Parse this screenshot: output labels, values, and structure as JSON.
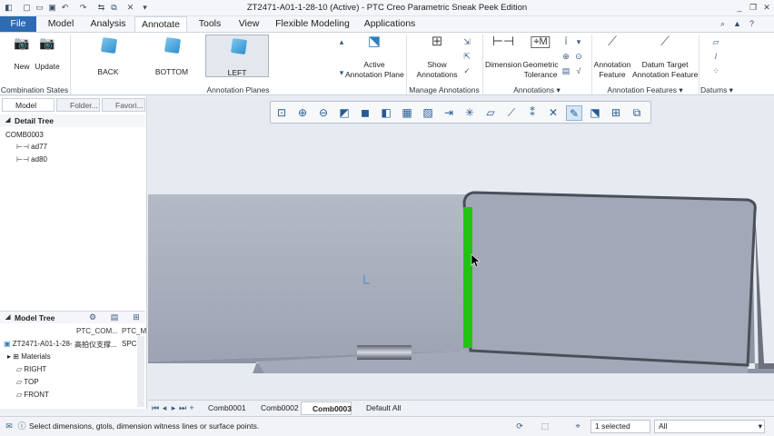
{
  "window": {
    "title": "ZT2471-A01-1-28-10 (Active) - PTC Creo Parametric Sneak Peek Edition",
    "controls": [
      "_",
      "❐",
      "✕"
    ]
  },
  "tabs": [
    "File",
    "Model",
    "Analysis",
    "Annotate",
    "Tools",
    "View",
    "Flexible Modeling",
    "Applications"
  ],
  "active_tab": "Annotate",
  "ribbon": {
    "combination_states": {
      "new": "New",
      "update": "Update",
      "label": "Combination States ▾"
    },
    "annotation_planes": {
      "back": "BACK",
      "bottom": "BOTTOM",
      "left": "LEFT",
      "active_plane": "Active\nAnnotation Plane",
      "label": "Annotation Planes"
    },
    "manage_annotations": {
      "show": "Show\nAnnotations",
      "label": "Manage Annotations ▾"
    },
    "annotations": {
      "dimension": "Dimension",
      "geometric_tolerance": "Geometric\nTolerance",
      "label": "Annotations ▾"
    },
    "annotation_features": {
      "annotation_feature": "Annotation\nFeature",
      "datum_target": "Datum Target\nAnnotation Feature",
      "label": "Annotation Features ▾"
    },
    "datums": {
      "label": "Datums ▾"
    }
  },
  "left_panel": {
    "tabs": [
      "Model Tree",
      "Folder...",
      "Favori..."
    ],
    "detail_tree": {
      "title": "Detail Tree",
      "root": "COMB0003",
      "items": [
        "ad77",
        "ad80"
      ]
    },
    "model_tree": {
      "title": "Model Tree",
      "columns": [
        "PTC_COM...",
        "PTC_M"
      ],
      "root": "ZT2471-A01-1-28-",
      "root_col1": "高拍仪支撑...",
      "root_col2": "SPCC",
      "items": [
        "Materials",
        "RIGHT",
        "TOP",
        "FRONT"
      ]
    }
  },
  "bottom_tabs": [
    "Comb0001",
    "Comb0002",
    "Comb0003",
    "Default All"
  ],
  "active_bottom_tab": "Comb0003",
  "status": {
    "message": "Select dimensions, gtols, dimension witness lines or surface points.",
    "selected": "1 selected",
    "filter": "All"
  },
  "colors": {
    "accent": "#2d6bb5",
    "highlight": "#22c413",
    "part": "#9ea4b4"
  }
}
